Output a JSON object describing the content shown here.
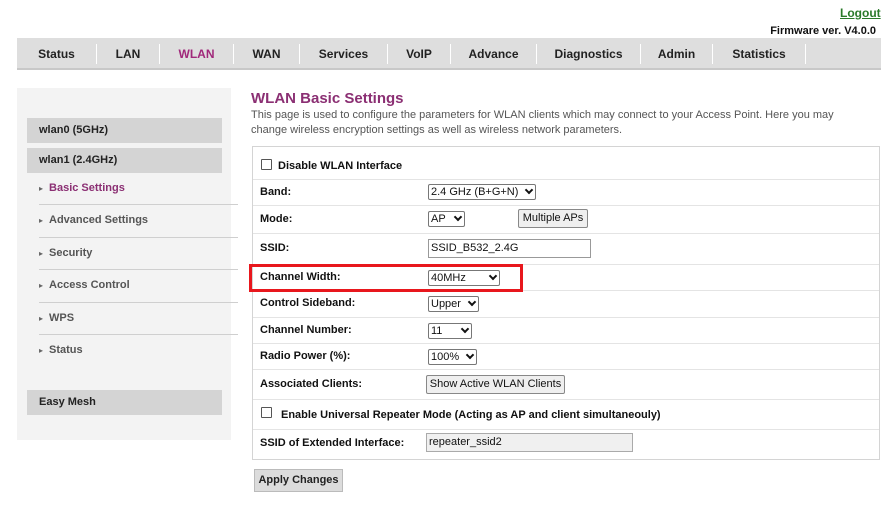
{
  "header": {
    "logout": "Logout",
    "firmware": "Firmware ver. V4.0.0"
  },
  "nav": {
    "tabs": [
      {
        "label": "Status"
      },
      {
        "label": "LAN"
      },
      {
        "label": "WLAN",
        "active": true
      },
      {
        "label": "WAN"
      },
      {
        "label": "Services"
      },
      {
        "label": "VoIP"
      },
      {
        "label": "Advance"
      },
      {
        "label": "Diagnostics"
      },
      {
        "label": "Admin"
      },
      {
        "label": "Statistics"
      }
    ]
  },
  "sidebar": {
    "headers": [
      "wlan0 (5GHz)",
      "wlan1 (2.4GHz)",
      "Easy Mesh"
    ],
    "items": [
      {
        "label": "Basic Settings",
        "active": true
      },
      {
        "label": "Advanced Settings"
      },
      {
        "label": "Security"
      },
      {
        "label": "Access Control"
      },
      {
        "label": "WPS"
      },
      {
        "label": "Status"
      }
    ]
  },
  "main": {
    "title": "WLAN Basic Settings",
    "description": "This page is used to configure the parameters for WLAN clients which may connect to your Access Point. Here you may change wireless encryption settings as well as wireless network parameters.",
    "form": {
      "disable_wlan": "Disable WLAN Interface",
      "band": {
        "label": "Band:",
        "value": "2.4 GHz (B+G+N)"
      },
      "mode": {
        "label": "Mode:",
        "value": "AP",
        "button": "Multiple APs"
      },
      "ssid": {
        "label": "SSID:",
        "value": "SSID_B532_2.4G"
      },
      "channel_width": {
        "label": "Channel Width:",
        "value": "40MHz"
      },
      "control_sideband": {
        "label": "Control Sideband:",
        "value": "Upper"
      },
      "channel_number": {
        "label": "Channel Number:",
        "value": "11"
      },
      "radio_power": {
        "label": "Radio Power (%):",
        "value": "100%"
      },
      "associated_clients": {
        "label": "Associated Clients:",
        "button": "Show Active WLAN Clients"
      },
      "repeater": "Enable Universal Repeater Mode (Acting as AP and client simultaneouly)",
      "ext_ssid": {
        "label": "SSID of Extended Interface:",
        "value": "repeater_ssid2"
      }
    },
    "apply": "Apply Changes"
  },
  "colors": {
    "accent": "#8b2f73",
    "highlight": "#e8171d",
    "logout": "#2a7a2a"
  }
}
